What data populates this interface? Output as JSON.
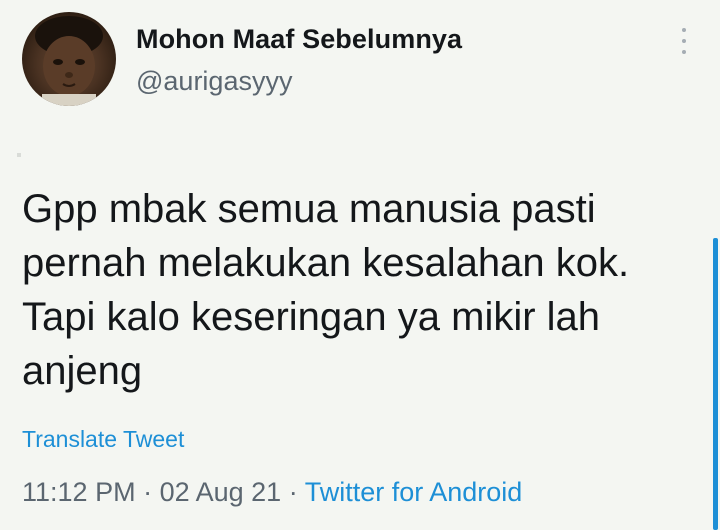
{
  "author": {
    "display_name": "Mohon Maaf Sebelumnya",
    "handle": "@aurigasyyy"
  },
  "tweet": {
    "text": "Gpp mbak semua manusia pasti\npernah melakukan kesalahan kok.\nTapi kalo keseringan ya mikir lah\nanjeng",
    "translate_label": "Translate Tweet",
    "time": "11:12 PM",
    "separator": " · ",
    "date": "02 Aug 21",
    "source": "Twitter for Android"
  },
  "icons": {
    "menu": "more-vertical-icon",
    "avatar": "avatar"
  },
  "colors": {
    "accent": "#1d8fd6",
    "text": "#14171a",
    "muted": "#5b6670",
    "background": "#f4f6f2"
  }
}
